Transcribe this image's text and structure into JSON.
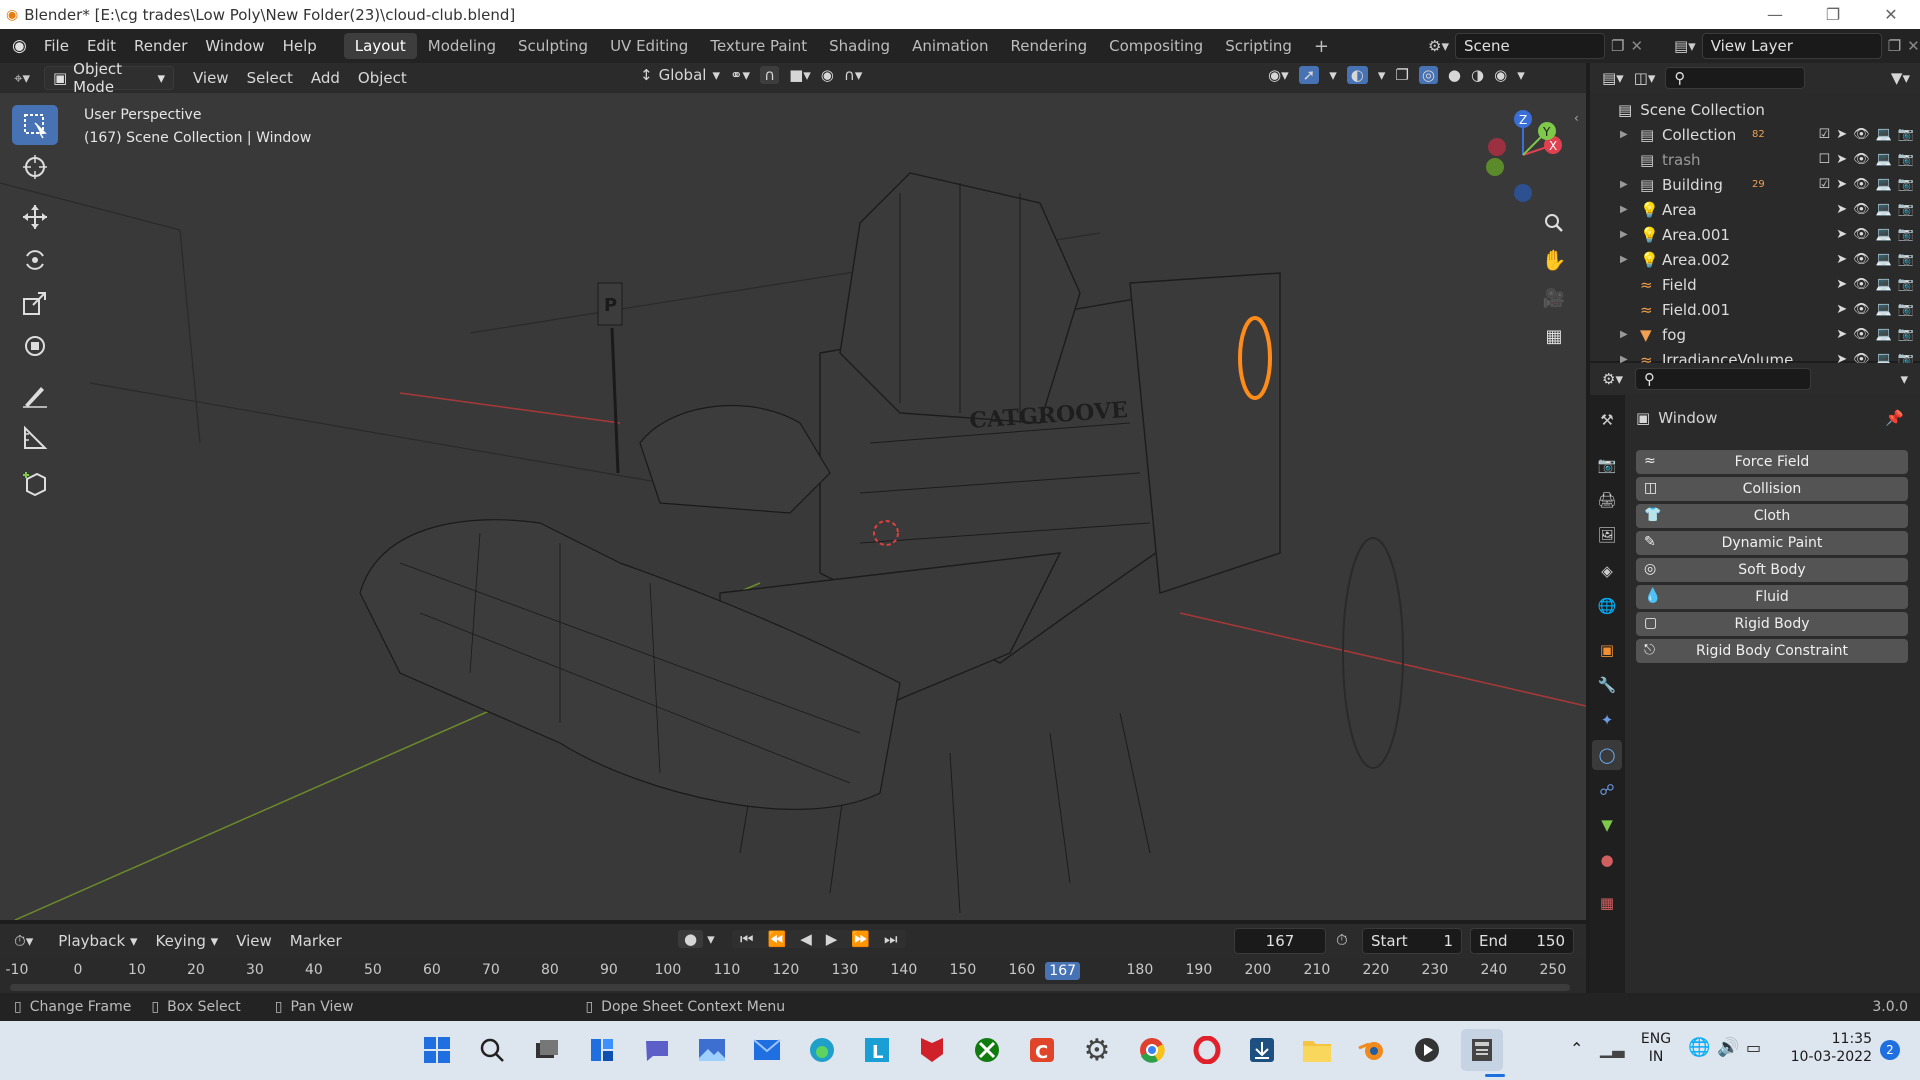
{
  "window": {
    "title": "Blender* [E:\\cg trades\\Low Poly\\New Folder(23)\\cloud-club.blend]"
  },
  "menubar": {
    "menus": [
      "File",
      "Edit",
      "Render",
      "Window",
      "Help"
    ],
    "workspaces": [
      "Layout",
      "Modeling",
      "Sculpting",
      "UV Editing",
      "Texture Paint",
      "Shading",
      "Animation",
      "Rendering",
      "Compositing",
      "Scripting"
    ],
    "active_workspace": "Layout",
    "scene": "Scene",
    "view_layer": "View Layer"
  },
  "viewport_header": {
    "mode": "Object Mode",
    "menus": [
      "View",
      "Select",
      "Add",
      "Object"
    ],
    "transform_orientation": "Global"
  },
  "viewport": {
    "perspective": "User Perspective",
    "context": "(167) Scene Collection | Window",
    "gizmo": {
      "x": "X",
      "y": "Y",
      "z": "Z"
    },
    "sign_text": "P",
    "club_sign": "CATGROOVE"
  },
  "outliner": {
    "root": "Scene Collection",
    "items": [
      {
        "label": "Collection",
        "badge": "82"
      },
      {
        "label": "trash",
        "badge": ""
      },
      {
        "label": "Building",
        "badge": "29"
      },
      {
        "label": "Area",
        "badge": ""
      },
      {
        "label": "Area.001",
        "badge": ""
      },
      {
        "label": "Area.002",
        "badge": ""
      },
      {
        "label": "Field",
        "badge": ""
      },
      {
        "label": "Field.001",
        "badge": ""
      },
      {
        "label": "fog",
        "badge": ""
      },
      {
        "label": "IrradianceVolume",
        "badge": ""
      }
    ]
  },
  "properties": {
    "object_name": "Window",
    "physics_buttons": [
      "Force Field",
      "Collision",
      "Cloth",
      "Dynamic Paint",
      "Soft Body",
      "Fluid",
      "Rigid Body",
      "Rigid Body Constraint"
    ]
  },
  "timeline": {
    "menus": [
      "Playback",
      "Keying",
      "View",
      "Marker"
    ],
    "current_frame": "167",
    "start_label": "Start",
    "start": "1",
    "end_label": "End",
    "end": "150",
    "ruler": [
      "-10",
      "0",
      "10",
      "20",
      "30",
      "40",
      "50",
      "60",
      "70",
      "80",
      "90",
      "100",
      "110",
      "120",
      "130",
      "140",
      "150",
      "160",
      "167",
      "180",
      "190",
      "200",
      "210",
      "220",
      "230",
      "240",
      "250"
    ]
  },
  "statusbar": {
    "items": [
      "Change Frame",
      "Box Select",
      "Pan View",
      "Dope Sheet Context Menu"
    ],
    "version": "3.0.0"
  },
  "taskbar": {
    "language": "ENG",
    "region": "IN",
    "time": "11:35",
    "date": "10-03-2022",
    "notifications": "2"
  },
  "colors": {
    "accent": "#4772b3",
    "active_frame": "#4772b3",
    "selection": "#ff8c1a"
  }
}
